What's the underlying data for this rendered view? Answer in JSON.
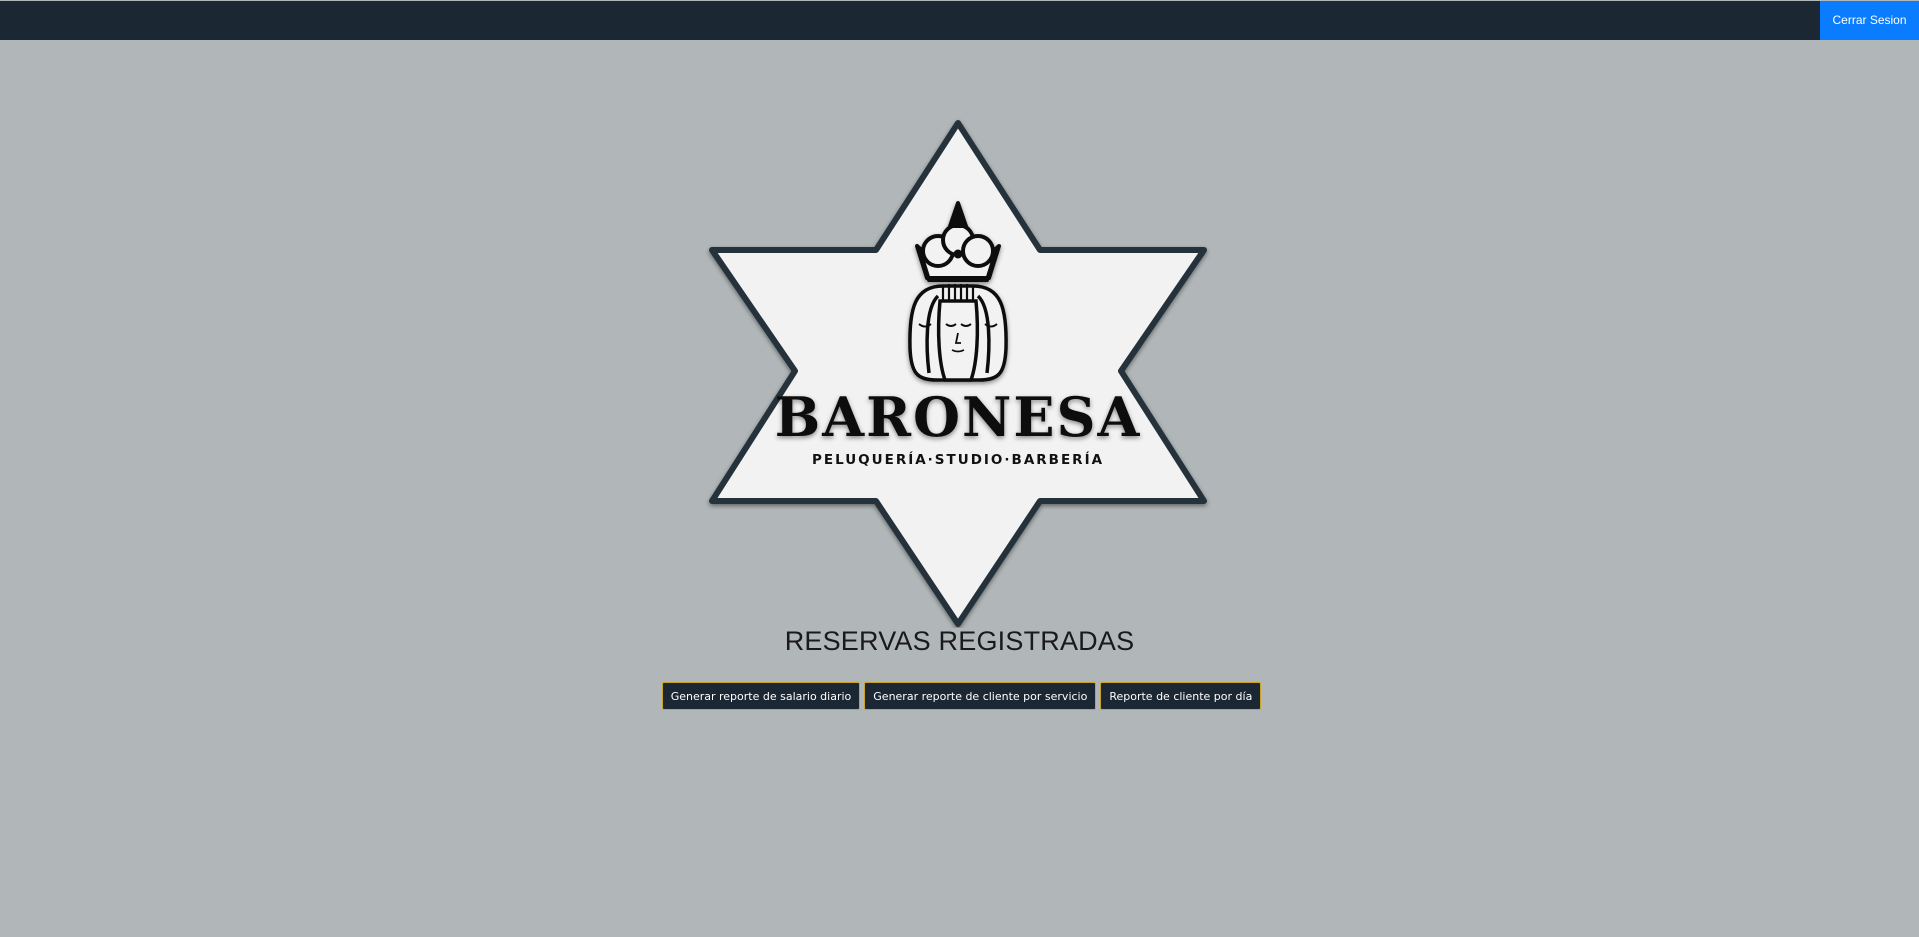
{
  "header": {
    "logout_label": "Cerrar Sesion"
  },
  "brand": {
    "name": "BARONESA",
    "tagline": "PELUQUERÍA·STUDIO·BARBERÍA",
    "logo_icon": "star-crown-face-logo-icon"
  },
  "main": {
    "title": "RESERVAS REGISTRADAS",
    "buttons": [
      {
        "label": "Generar reporte de salario diario"
      },
      {
        "label": "Generar reporte de cliente por servicio"
      },
      {
        "label": "Reporte de cliente por día"
      }
    ]
  },
  "colors": {
    "background": "#b1b7b9",
    "topbar": "#1c2734",
    "logout_button": "#0a7cff",
    "report_button": "#1c2734",
    "report_button_border": "#c9a227",
    "logo_fill": "#f2f2f2",
    "logo_stroke": "#27313b"
  }
}
